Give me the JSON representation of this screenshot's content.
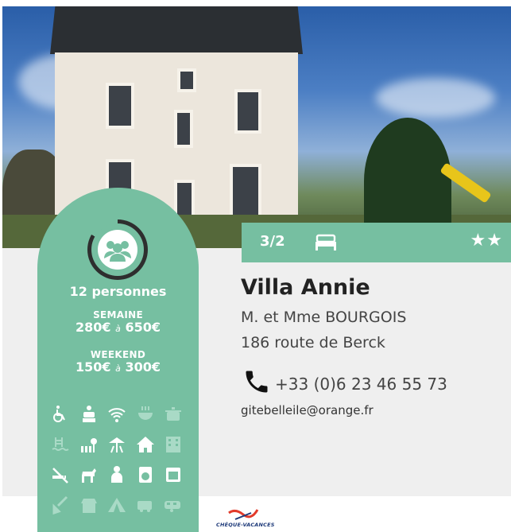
{
  "listing": {
    "name": "Villa Annie",
    "owner": "M. et Mme BOURGOIS",
    "address": "186 route de Berck",
    "phone": "+33 (0)6 23 46 55 73",
    "email": "gitebelleile@orange.fr",
    "rooms": "3/2",
    "stars": "★★"
  },
  "capacity": "12 personnes",
  "prices": {
    "week_label": "SEMAINE",
    "week_from": "280€",
    "week_to": "650€",
    "weekend_label": "WEEKEND",
    "weekend_from": "150€",
    "weekend_to": "300€",
    "separator": "à"
  },
  "logo": {
    "text": "CHÈQUE-VACANCES"
  },
  "colors": {
    "accent": "#76bfa1",
    "panel": "#efefef",
    "inactive_icon": "#a9dac6"
  },
  "amenities": [
    {
      "name": "wheelchair-icon",
      "active": true
    },
    {
      "name": "family-pack-icon",
      "active": true
    },
    {
      "name": "wifi-icon",
      "active": true
    },
    {
      "name": "bbq-icon",
      "active": false
    },
    {
      "name": "cooking-pot-icon",
      "active": false
    },
    {
      "name": "pool-icon",
      "active": false
    },
    {
      "name": "garden-icon",
      "active": true
    },
    {
      "name": "playground-icon",
      "active": true
    },
    {
      "name": "house-icon",
      "active": true
    },
    {
      "name": "building-icon",
      "active": false
    },
    {
      "name": "no-smoking-icon",
      "active": true
    },
    {
      "name": "pets-icon",
      "active": true
    },
    {
      "name": "cleaning-person-icon",
      "active": true
    },
    {
      "name": "washing-machine-icon",
      "active": true
    },
    {
      "name": "tv-icon",
      "active": true
    },
    {
      "name": "cleaning-icon",
      "active": false
    },
    {
      "name": "shop-icon",
      "active": false
    },
    {
      "name": "tent-icon",
      "active": false
    },
    {
      "name": "camper-icon",
      "active": false
    },
    {
      "name": "caravan-icon",
      "active": false
    }
  ]
}
